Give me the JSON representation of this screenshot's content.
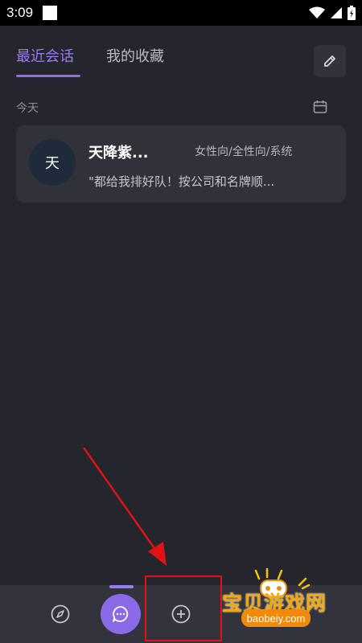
{
  "status_bar": {
    "time": "3:09"
  },
  "tabs": [
    {
      "label": "最近会话",
      "active": true
    },
    {
      "label": "我的收藏",
      "active": false
    }
  ],
  "section": {
    "label": "今天"
  },
  "conversation": {
    "avatar_char": "天",
    "name": "天降紫...",
    "tags": "女性向/全性向/系统",
    "preview": "\"都给我排好队！按公司和名牌顺..."
  },
  "bottom_nav": {
    "items": [
      {
        "icon": "compass-icon"
      },
      {
        "icon": "chat-icon",
        "active": true
      },
      {
        "icon": "plus-circle-icon"
      }
    ]
  },
  "watermark": {
    "name": "宝贝游戏网",
    "domain": "baobeiy.com"
  },
  "colors": {
    "accent": "#8f6ee8",
    "background": "#25252e",
    "card": "#31313a",
    "annotation": "#e31212",
    "watermark": "#f5a70c"
  }
}
